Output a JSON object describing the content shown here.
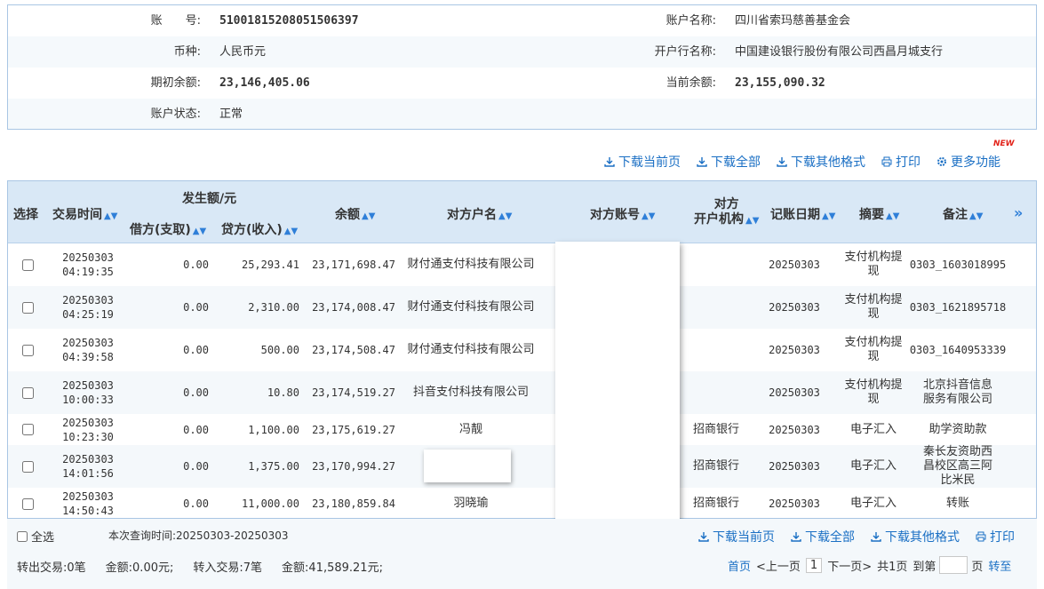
{
  "account": {
    "no_label": "账　　号:",
    "no_value": "51001815208051506397",
    "name_label": "账户名称:",
    "name_value": "四川省索玛慈善基金会",
    "currency_label": "币种:",
    "currency_value": "人民币元",
    "bank_label": "开户行名称:",
    "bank_value": "中国建设银行股份有限公司西昌月城支行",
    "opening_label": "期初余额:",
    "opening_value": "23,146,405.06",
    "current_label": "当前余额:",
    "current_value": "23,155,090.32",
    "status_label": "账户状态:",
    "status_value": "正常"
  },
  "toolbar": {
    "download_page": "下载当前页",
    "download_all": "下载全部",
    "download_other": "下载其他格式",
    "print": "打印",
    "more": "更多功能",
    "new_badge": "NEW"
  },
  "table": {
    "headers": {
      "select": "选择",
      "time": "交易时间",
      "amount_group": "发生额/元",
      "debit": "借方(支取)",
      "credit": "贷方(收入)",
      "balance": "余额",
      "cp_name": "对方户名",
      "cp_account": "对方账号",
      "cp_bank_1": "对方",
      "cp_bank_2": "开户机构",
      "post_date": "记账日期",
      "summary": "摘要",
      "remark": "备注",
      "expand": "»"
    },
    "rows": [
      {
        "date": "20250303",
        "time": "04:19:35",
        "debit": "0.00",
        "credit": "25,293.41",
        "balance": "23,171,698.47",
        "name": "财付通支付科技有限公司",
        "bank": "",
        "post": "20250303",
        "summary": "支付机构提现",
        "remark": "0303_1603018995"
      },
      {
        "date": "20250303",
        "time": "04:25:19",
        "debit": "0.00",
        "credit": "2,310.00",
        "balance": "23,174,008.47",
        "name": "财付通支付科技有限公司",
        "bank": "",
        "post": "20250303",
        "summary": "支付机构提现",
        "remark": "0303_1621895718"
      },
      {
        "date": "20250303",
        "time": "04:39:58",
        "debit": "0.00",
        "credit": "500.00",
        "balance": "23,174,508.47",
        "name": "财付通支付科技有限公司",
        "bank": "",
        "post": "20250303",
        "summary": "支付机构提现",
        "remark": "0303_1640953339"
      },
      {
        "date": "20250303",
        "time": "10:00:33",
        "debit": "0.00",
        "credit": "10.80",
        "balance": "23,174,519.27",
        "name": "抖音支付科技有限公司",
        "bank": "",
        "post": "20250303",
        "summary": "支付机构提现",
        "remark": "北京抖音信息服务有限公司"
      },
      {
        "date": "20250303",
        "time": "10:23:30",
        "debit": "0.00",
        "credit": "1,100.00",
        "balance": "23,175,619.27",
        "name": "冯靓",
        "bank": "招商银行",
        "post": "20250303",
        "summary": "电子汇入",
        "remark": "助学资助款"
      },
      {
        "date": "20250303",
        "time": "14:01:56",
        "debit": "0.00",
        "credit": "1,375.00",
        "balance": "23,170,994.27",
        "name": "",
        "bank": "招商银行",
        "post": "20250303",
        "summary": "电子汇入",
        "remark": "秦长友资助西昌校区高三阿比米民"
      },
      {
        "date": "20250303",
        "time": "14:50:43",
        "debit": "0.00",
        "credit": "11,000.00",
        "balance": "23,180,859.84",
        "name": "羽晓瑜",
        "bank": "招商银行",
        "post": "20250303",
        "summary": "电子汇入",
        "remark": "转账"
      }
    ]
  },
  "footer": {
    "select_all": "全选",
    "query_time": "本次查询时间:20250303-20250303",
    "out_count": "转出交易:0笔",
    "out_amount": "金额:0.00元;",
    "in_count": "转入交易:7笔",
    "in_amount": "金额:41,589.21元;",
    "first": "首页",
    "prev": "<上一页",
    "page": "1",
    "next": "下一页>",
    "total": "共1页",
    "goto": "到第",
    "page_unit": "页",
    "go": "转至"
  }
}
